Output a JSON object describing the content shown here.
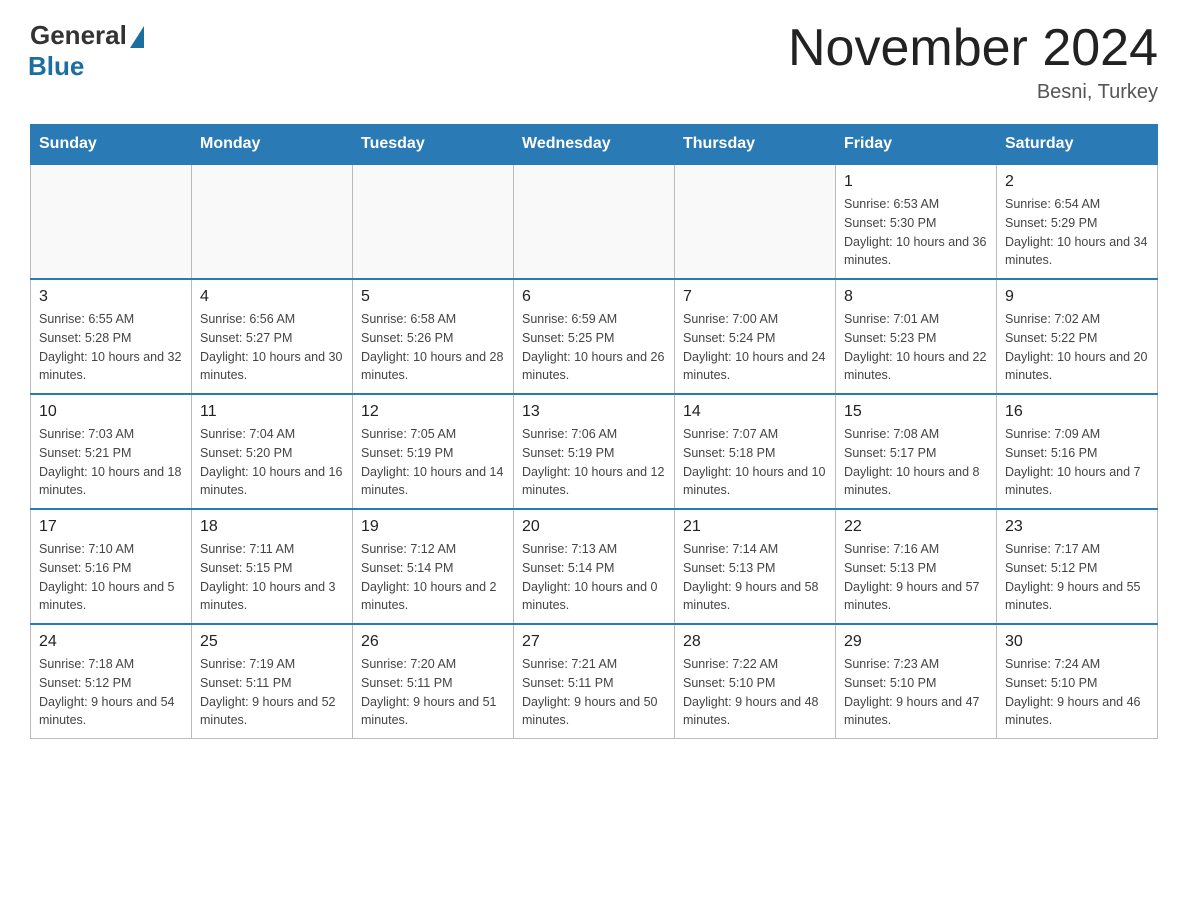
{
  "header": {
    "logo_general": "General",
    "logo_blue": "Blue",
    "month_title": "November 2024",
    "location": "Besni, Turkey"
  },
  "weekdays": [
    "Sunday",
    "Monday",
    "Tuesday",
    "Wednesday",
    "Thursday",
    "Friday",
    "Saturday"
  ],
  "weeks": [
    [
      {
        "day": "",
        "info": ""
      },
      {
        "day": "",
        "info": ""
      },
      {
        "day": "",
        "info": ""
      },
      {
        "day": "",
        "info": ""
      },
      {
        "day": "",
        "info": ""
      },
      {
        "day": "1",
        "info": "Sunrise: 6:53 AM\nSunset: 5:30 PM\nDaylight: 10 hours and 36 minutes."
      },
      {
        "day": "2",
        "info": "Sunrise: 6:54 AM\nSunset: 5:29 PM\nDaylight: 10 hours and 34 minutes."
      }
    ],
    [
      {
        "day": "3",
        "info": "Sunrise: 6:55 AM\nSunset: 5:28 PM\nDaylight: 10 hours and 32 minutes."
      },
      {
        "day": "4",
        "info": "Sunrise: 6:56 AM\nSunset: 5:27 PM\nDaylight: 10 hours and 30 minutes."
      },
      {
        "day": "5",
        "info": "Sunrise: 6:58 AM\nSunset: 5:26 PM\nDaylight: 10 hours and 28 minutes."
      },
      {
        "day": "6",
        "info": "Sunrise: 6:59 AM\nSunset: 5:25 PM\nDaylight: 10 hours and 26 minutes."
      },
      {
        "day": "7",
        "info": "Sunrise: 7:00 AM\nSunset: 5:24 PM\nDaylight: 10 hours and 24 minutes."
      },
      {
        "day": "8",
        "info": "Sunrise: 7:01 AM\nSunset: 5:23 PM\nDaylight: 10 hours and 22 minutes."
      },
      {
        "day": "9",
        "info": "Sunrise: 7:02 AM\nSunset: 5:22 PM\nDaylight: 10 hours and 20 minutes."
      }
    ],
    [
      {
        "day": "10",
        "info": "Sunrise: 7:03 AM\nSunset: 5:21 PM\nDaylight: 10 hours and 18 minutes."
      },
      {
        "day": "11",
        "info": "Sunrise: 7:04 AM\nSunset: 5:20 PM\nDaylight: 10 hours and 16 minutes."
      },
      {
        "day": "12",
        "info": "Sunrise: 7:05 AM\nSunset: 5:19 PM\nDaylight: 10 hours and 14 minutes."
      },
      {
        "day": "13",
        "info": "Sunrise: 7:06 AM\nSunset: 5:19 PM\nDaylight: 10 hours and 12 minutes."
      },
      {
        "day": "14",
        "info": "Sunrise: 7:07 AM\nSunset: 5:18 PM\nDaylight: 10 hours and 10 minutes."
      },
      {
        "day": "15",
        "info": "Sunrise: 7:08 AM\nSunset: 5:17 PM\nDaylight: 10 hours and 8 minutes."
      },
      {
        "day": "16",
        "info": "Sunrise: 7:09 AM\nSunset: 5:16 PM\nDaylight: 10 hours and 7 minutes."
      }
    ],
    [
      {
        "day": "17",
        "info": "Sunrise: 7:10 AM\nSunset: 5:16 PM\nDaylight: 10 hours and 5 minutes."
      },
      {
        "day": "18",
        "info": "Sunrise: 7:11 AM\nSunset: 5:15 PM\nDaylight: 10 hours and 3 minutes."
      },
      {
        "day": "19",
        "info": "Sunrise: 7:12 AM\nSunset: 5:14 PM\nDaylight: 10 hours and 2 minutes."
      },
      {
        "day": "20",
        "info": "Sunrise: 7:13 AM\nSunset: 5:14 PM\nDaylight: 10 hours and 0 minutes."
      },
      {
        "day": "21",
        "info": "Sunrise: 7:14 AM\nSunset: 5:13 PM\nDaylight: 9 hours and 58 minutes."
      },
      {
        "day": "22",
        "info": "Sunrise: 7:16 AM\nSunset: 5:13 PM\nDaylight: 9 hours and 57 minutes."
      },
      {
        "day": "23",
        "info": "Sunrise: 7:17 AM\nSunset: 5:12 PM\nDaylight: 9 hours and 55 minutes."
      }
    ],
    [
      {
        "day": "24",
        "info": "Sunrise: 7:18 AM\nSunset: 5:12 PM\nDaylight: 9 hours and 54 minutes."
      },
      {
        "day": "25",
        "info": "Sunrise: 7:19 AM\nSunset: 5:11 PM\nDaylight: 9 hours and 52 minutes."
      },
      {
        "day": "26",
        "info": "Sunrise: 7:20 AM\nSunset: 5:11 PM\nDaylight: 9 hours and 51 minutes."
      },
      {
        "day": "27",
        "info": "Sunrise: 7:21 AM\nSunset: 5:11 PM\nDaylight: 9 hours and 50 minutes."
      },
      {
        "day": "28",
        "info": "Sunrise: 7:22 AM\nSunset: 5:10 PM\nDaylight: 9 hours and 48 minutes."
      },
      {
        "day": "29",
        "info": "Sunrise: 7:23 AM\nSunset: 5:10 PM\nDaylight: 9 hours and 47 minutes."
      },
      {
        "day": "30",
        "info": "Sunrise: 7:24 AM\nSunset: 5:10 PM\nDaylight: 9 hours and 46 minutes."
      }
    ]
  ]
}
